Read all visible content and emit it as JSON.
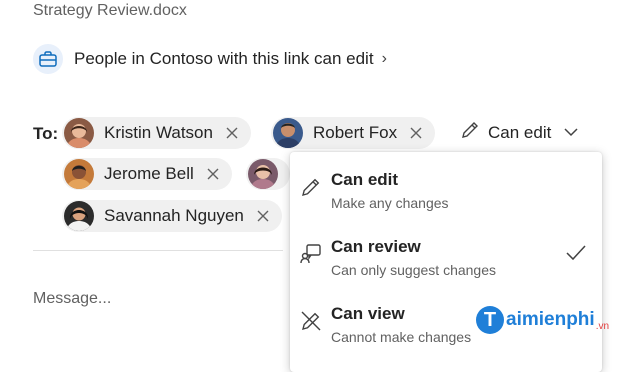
{
  "document": {
    "title": "Strategy Review.docx"
  },
  "share_link": {
    "text": "People in Contoso with this link can edit",
    "chevron": "›",
    "icon": "briefcase-icon"
  },
  "to_label": "To:",
  "recipients": [
    {
      "name": "Kristin Watson",
      "avatar_color": "#8a5a44"
    },
    {
      "name": "Robert Fox",
      "avatar_color": "#3a5a8c"
    },
    {
      "name": "Jerome Bell",
      "avatar_color": "#c47a3a"
    },
    {
      "name": "",
      "avatar_color": "#7a5a6a"
    },
    {
      "name": "Savannah Nguyen",
      "avatar_color": "#2b2b2b"
    }
  ],
  "permission_select": {
    "label": "Can edit",
    "icon": "pencil-icon"
  },
  "message": {
    "placeholder": "Message..."
  },
  "permission_menu": {
    "items": [
      {
        "title": "Can edit",
        "description": "Make any changes",
        "icon": "pencil-icon",
        "selected": false
      },
      {
        "title": "Can review",
        "description": "Can only suggest changes",
        "icon": "review-icon",
        "selected": true
      },
      {
        "title": "Can view",
        "description": "Cannot make changes",
        "icon": "no-edit-icon",
        "selected": false
      }
    ]
  },
  "watermark": {
    "logo": "T",
    "text": "aimienphi",
    "suffix": ".vn"
  },
  "colors": {
    "accent": "#0f6cbd",
    "chip_bg": "#f0f0f0",
    "watermark": "#1f7fd8"
  }
}
